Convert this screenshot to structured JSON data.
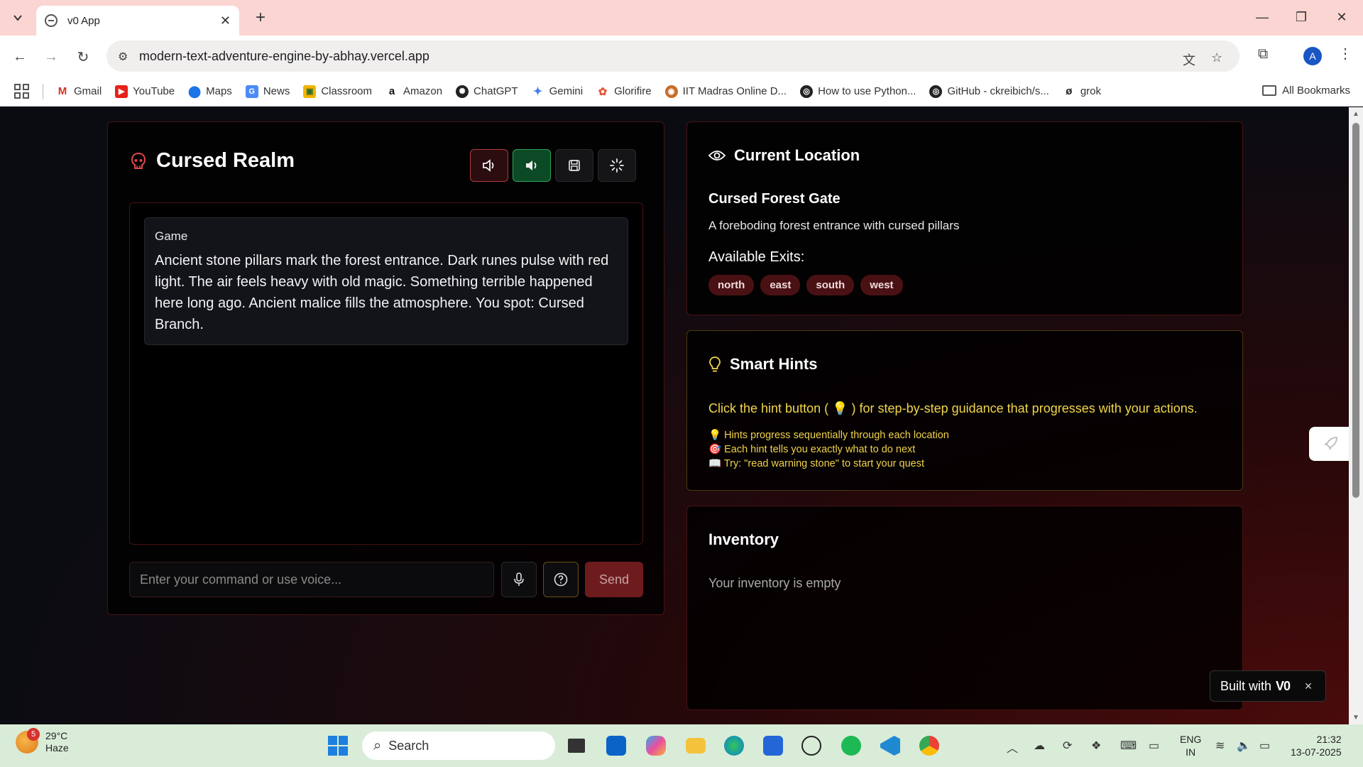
{
  "browser": {
    "tab_title": "v0 App",
    "url": "modern-text-adventure-engine-by-abhay.vercel.app",
    "bookmarks": [
      "Gmail",
      "YouTube",
      "Maps",
      "News",
      "Classroom",
      "Amazon",
      "ChatGPT",
      "Gemini",
      "Glorifire",
      "IIT Madras Online D...",
      "How to use Python...",
      "GitHub - ckreibich/s...",
      "grok"
    ],
    "all_bookmarks": "All Bookmarks",
    "profile_initial": "A"
  },
  "game": {
    "title": "Cursed Realm",
    "log_sender": "Game",
    "log_text": "Ancient stone pillars mark the forest entrance. Dark runes pulse with red light. The air feels heavy with old magic. Something terrible happened here long ago. Ancient malice fills the atmosphere. You spot: Cursed Branch.",
    "input_placeholder": "Enter your command or use voice...",
    "send_label": "Send"
  },
  "location": {
    "heading": "Current Location",
    "name": "Cursed Forest Gate",
    "description": "A foreboding forest entrance with cursed pillars",
    "exits_label": "Available Exits:",
    "exits": [
      "north",
      "east",
      "south",
      "west"
    ]
  },
  "hints": {
    "heading": "Smart Hints",
    "main_before": "Click the hint button (",
    "main_icon": "💡",
    "main_after": ") for step-by-step guidance that progresses with your actions.",
    "items": [
      "💡 Hints progress sequentially through each location",
      "🎯 Each hint tells you exactly what to do next",
      "📖 Try: \"read warning stone\" to start your quest"
    ]
  },
  "inventory": {
    "heading": "Inventory",
    "empty_text": "Your inventory is empty"
  },
  "v0_badge": {
    "label": "Built with",
    "brand": "V0"
  },
  "taskbar": {
    "weather_badge": "5",
    "temperature": "29°C",
    "condition": "Haze",
    "search_label": "Search",
    "lang_1": "ENG",
    "lang_2": "IN",
    "time": "21:32",
    "date": "13-07-2025"
  },
  "colors": {
    "accent_red": "#6e1b1e",
    "hint_yellow": "#f2d64a",
    "voice_green": "#0c4a25"
  }
}
